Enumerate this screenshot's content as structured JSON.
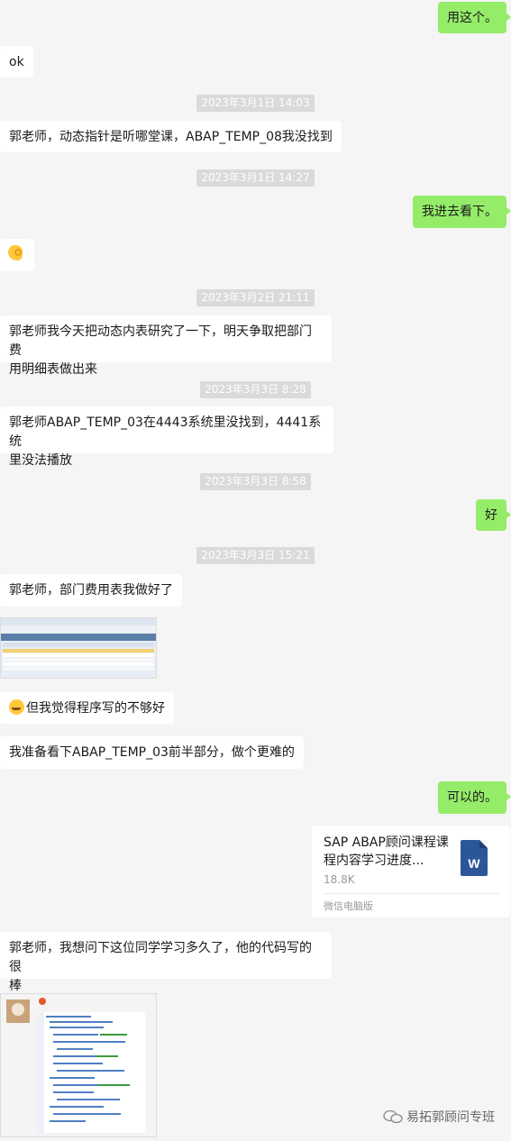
{
  "messages": {
    "m1": "用这个。",
    "m2": "ok",
    "t1": "2023年3月1日 14:03",
    "m3": "郭老师，动态指针是听哪堂课，ABAP_TEMP_08我没找到",
    "t2": "2023年3月1日 14:27",
    "m4": "我进去看下。",
    "t3": "2023年3月2日 21:11",
    "m5_line1": "郭老师我今天把动态内表研究了一下，明天争取把部门费",
    "m5_line2": "用明细表做出来",
    "t4": "2023年3月3日 8:28",
    "m6_line1": "郭老师ABAP_TEMP_03在4443系统里没找到，4441系统",
    "m6_line2": "里没法播放",
    "t5": "2023年3月3日 8:58",
    "m7": "好",
    "t6": "2023年3月3日 15:21",
    "m8": "郭老师，部门费用表我做好了",
    "m9": "但我觉得程序写的不够好",
    "m10": "我准备看下ABAP_TEMP_03前半部分，做个更难的",
    "m11": "可以的。",
    "m12_line1": "郭老师，我想问下这位同学学习多久了，他的代码写的很",
    "m12_line2": "棒"
  },
  "file": {
    "name_line1": "SAP ABAP顾问课程课",
    "name_line2": "程内容学习进度...",
    "size": "18.8K",
    "source": "微信电脑版",
    "icon_letter": "W"
  },
  "watermark": "易拓郭顾问专班",
  "colors": {
    "own_bubble": "#95ec69",
    "other_bubble": "#ffffff",
    "background": "#f5f5f5"
  }
}
